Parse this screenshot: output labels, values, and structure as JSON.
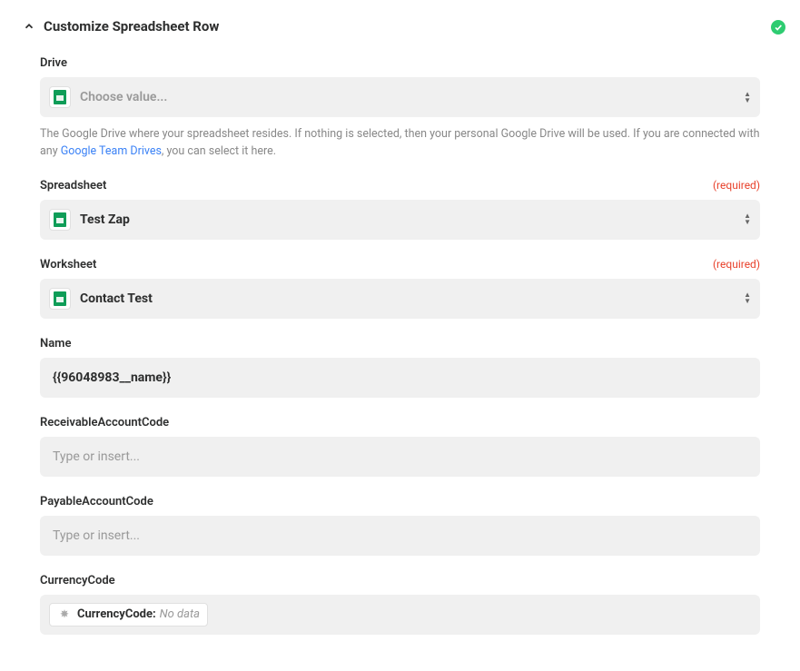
{
  "header": {
    "title": "Customize Spreadsheet Row"
  },
  "fields": {
    "drive": {
      "label": "Drive",
      "placeholder": "Choose value...",
      "help_pre": "The Google Drive where your spreadsheet resides. If nothing is selected, then your personal Google Drive will be used. If you are connected with any ",
      "help_link": "Google Team Drives",
      "help_post": ", you can select it here."
    },
    "spreadsheet": {
      "label": "Spreadsheet",
      "required": "(required)",
      "value": "Test Zap"
    },
    "worksheet": {
      "label": "Worksheet",
      "required": "(required)",
      "value": "Contact Test"
    },
    "name": {
      "label": "Name",
      "value": "{{96048983__name}}"
    },
    "receivable": {
      "label": "ReceivableAccountCode",
      "placeholder": "Type or insert..."
    },
    "payable": {
      "label": "PayableAccountCode",
      "placeholder": "Type or insert..."
    },
    "currency": {
      "label": "CurrencyCode",
      "pill_label": "CurrencyCode:",
      "pill_value": "No data"
    }
  }
}
